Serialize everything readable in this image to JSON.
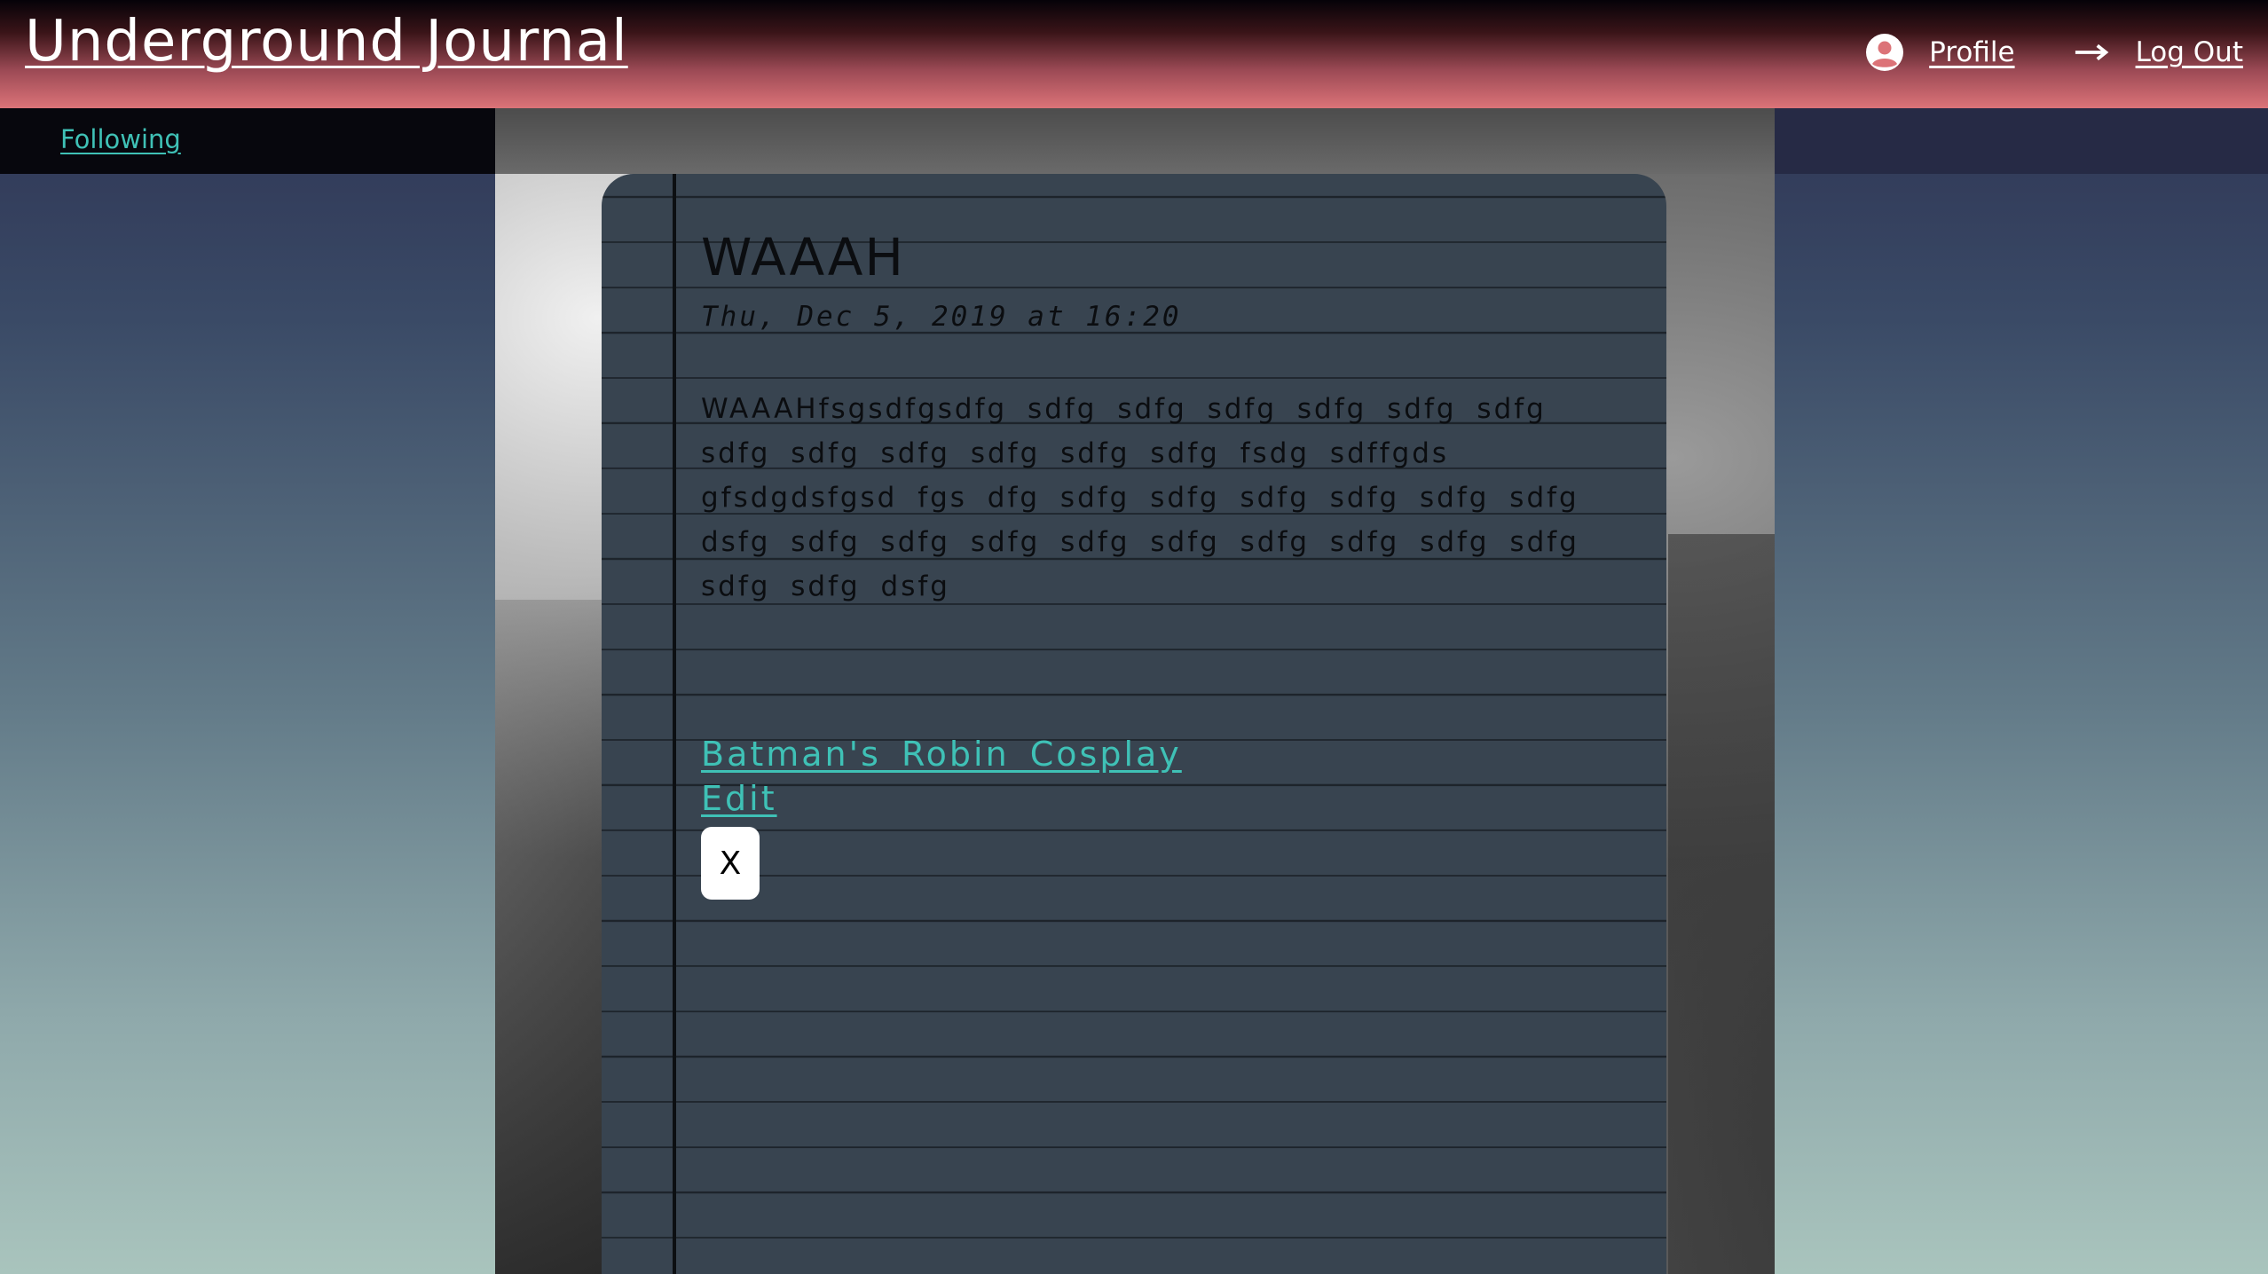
{
  "header": {
    "brand": "Underground Journal",
    "profile_label": "Profile",
    "logout_label": "Log Out",
    "profile_icon": "user-circle-icon",
    "logout_icon": "arrow-right-icon"
  },
  "subnav": {
    "following_label": "Following"
  },
  "entry": {
    "title": "WAAAH",
    "date": "Thu, Dec 5, 2019 at 16:20",
    "body": "WAAAHfsgsdfgsdfg sdfg sdfg sdfg sdfg sdfg sdfg sdfg sdfg sdfg sdfg sdfg sdfg fsdg sdffgds gfsdgdsfgsd fgs dfg sdfg sdfg sdfg sdfg sdfg sdfg dsfg sdfg sdfg sdfg sdfg sdfg sdfg sdfg sdfg sdfg sdfg sdfg dsfg",
    "link_label": "Batman's Robin Cosplay",
    "edit_label": "Edit",
    "delete_label": "X"
  },
  "colors": {
    "accent": "#3fc1b6",
    "card": "#384450",
    "header_bottom": "#dc7378"
  }
}
